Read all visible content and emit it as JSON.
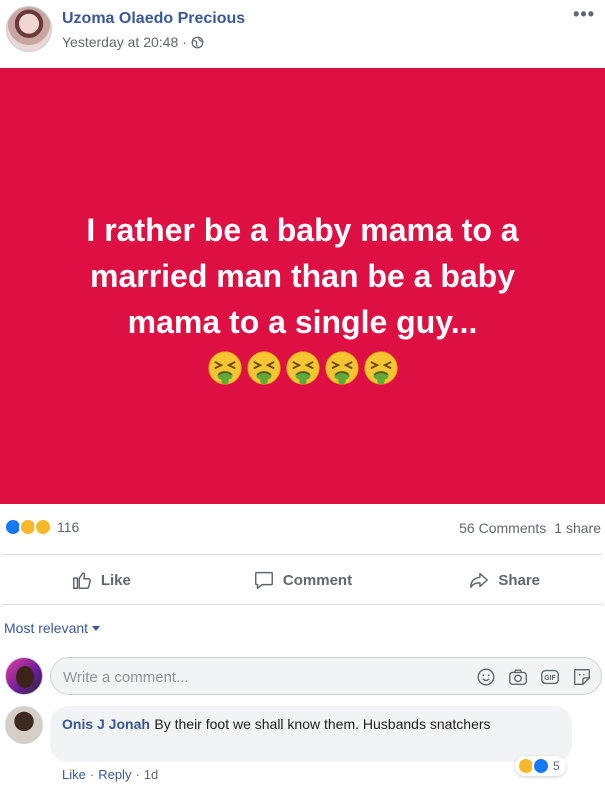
{
  "post": {
    "author": "Uzoma Olaedo Precious",
    "timestamp": "Yesterday at 20:48",
    "separator": "·",
    "privacy_icon": "globe-icon",
    "more_label": "•••",
    "text": "I rather be a baby mama to a married man than be a baby mama to a single guy...",
    "background_color": "#de0f42",
    "emoji": [
      "nauseated-face",
      "nauseated-face",
      "nauseated-face",
      "nauseated-face",
      "nauseated-face"
    ]
  },
  "reactions": {
    "icons": [
      "like",
      "haha",
      "wow"
    ],
    "count": "116",
    "comments": "56 Comments",
    "shares": "1 share"
  },
  "actions": {
    "like": "Like",
    "comment": "Comment",
    "share": "Share"
  },
  "comments_section": {
    "sort_label": "Most relevant",
    "composer_placeholder": "Write a comment...",
    "composer_tools": [
      "emoji-icon",
      "camera-icon",
      "gif-icon",
      "sticker-icon"
    ],
    "comments": [
      {
        "author": "Onis J Jonah",
        "text": "By their foot we shall know them. Husbands snatchers",
        "like": "Like",
        "reply": "Reply",
        "sep": "·",
        "time": "1d",
        "reaction_icons": [
          "haha",
          "like"
        ],
        "reaction_count": "5"
      }
    ]
  },
  "colors": {
    "link": "#385898",
    "secondary_text": "#606770",
    "like_blue": "#1877f2",
    "reaction_yellow": "#f7b928"
  }
}
